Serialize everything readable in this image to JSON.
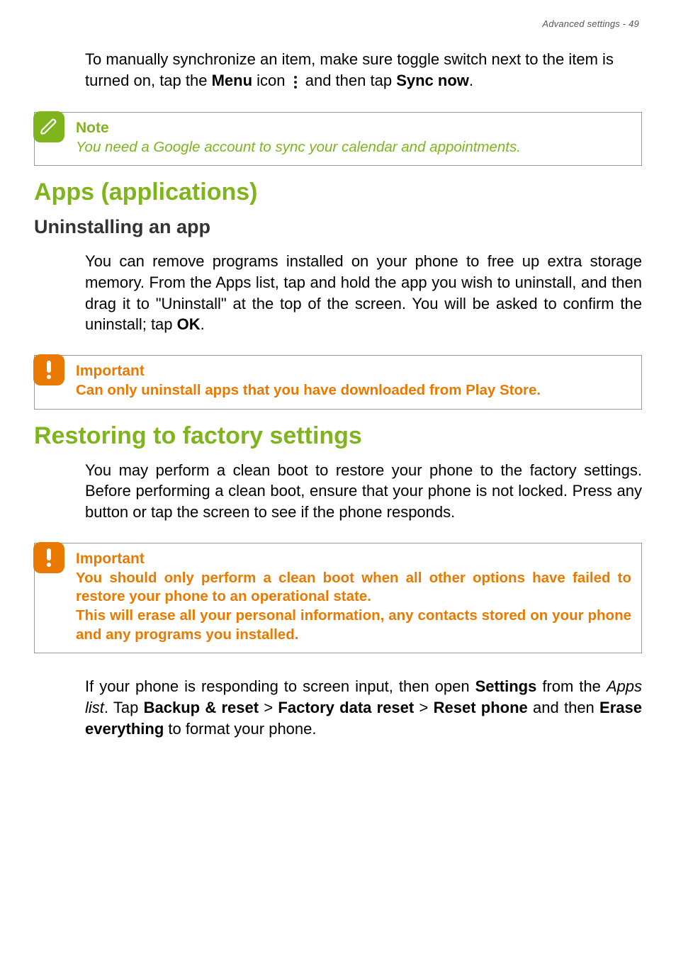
{
  "header": {
    "running_head": "Advanced settings - 49"
  },
  "intro_para": {
    "part1": "To manually synchronize an item, make sure toggle switch next to the item is turned on, tap the ",
    "menu_bold": "Menu",
    "part2": " icon ",
    "part3": " and then tap ",
    "sync_bold": "Sync now",
    "part4": "."
  },
  "note_box": {
    "title": "Note",
    "body": "You need a Google account to sync your calendar and appointments."
  },
  "apps_section": {
    "heading": "Apps (applications)",
    "subheading": "Uninstalling an app",
    "para_part1": "You can remove programs installed on your phone to free up extra storage memory. From the Apps list, tap and hold the app you wish to uninstall, and then drag it to \"Uninstall\" at the top of the screen. You will be asked to confirm the uninstall; tap ",
    "ok_bold": "OK",
    "para_part2": "."
  },
  "important_box1": {
    "title": "Important",
    "body": "Can only uninstall apps that you have downloaded from Play Store."
  },
  "restore_section": {
    "heading": "Restoring to factory settings",
    "para1": "You may perform a clean boot to restore your phone to the factory settings. Before performing a clean boot, ensure that your phone is not locked. Press any button or tap the screen to see if the phone responds."
  },
  "important_box2": {
    "title": "Important",
    "line1": "You should only perform a clean boot when all other options have failed to restore your phone to an operational state.",
    "line2": "This will erase all your personal information, any contacts stored on your phone and any programs you installed."
  },
  "final_para": {
    "p1": "If your phone is responding to screen input, then open ",
    "settings_bold": "Settings",
    "p2": " from the ",
    "apps_list_italic": "Apps list",
    "p3": ". Tap ",
    "backup_bold": "Backup & reset",
    "gt1": " > ",
    "factory_bold": "Factory data reset",
    "gt2": " > ",
    "reset_bold": "Reset phone",
    "p4": " and then ",
    "erase_bold": "Erase everything",
    "p5": " to format your phone."
  },
  "icons": {
    "note": "pencil-icon",
    "important": "exclamation-icon",
    "menu": "kebab-menu-icon"
  }
}
